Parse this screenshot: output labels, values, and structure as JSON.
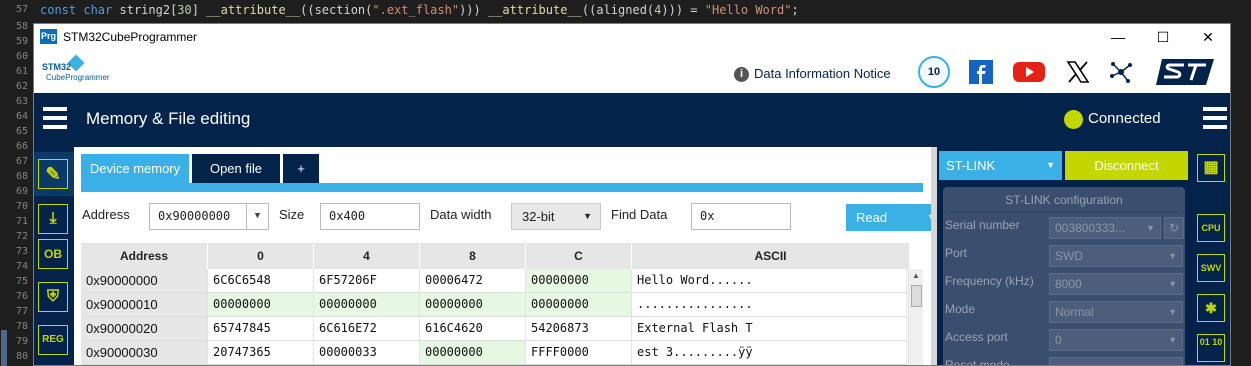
{
  "editor": {
    "line_numbers": [
      "57",
      "58",
      "59",
      "60",
      "61",
      "62",
      "63",
      "64",
      "65",
      "66",
      "67",
      "68",
      "69",
      "70",
      "71",
      "72",
      "73",
      "74",
      "75",
      "76",
      "77",
      "78",
      "79",
      "80"
    ],
    "code_line": {
      "kw1": "const",
      "kw2": "char",
      "ident": " string2[",
      "num1": "30",
      "close": "] ",
      "attr1": "__attribute__",
      "sec_open": "((section(",
      "sec_str": "\".ext_flash\"",
      "sec_close": "))) ",
      "attr2": "__attribute__",
      "al_open": "((aligned(",
      "num2": "4",
      "al_close": "))) = ",
      "value": "\"Hello Word\"",
      "semi": ";"
    }
  },
  "window": {
    "app_icon": "Prg",
    "title": "STM32CubeProgrammer",
    "minimize": "—",
    "maximize": "☐",
    "close": "✕"
  },
  "brand": {
    "logo_line1": "STM32",
    "logo_line2": "CubeProgrammer",
    "info_icon": "i",
    "info_link": "Data Information Notice",
    "badge": "10",
    "social_icons": [
      "facebook-icon",
      "youtube-icon",
      "x-icon",
      "network-icon",
      "st-logo"
    ],
    "st_logo": "ST"
  },
  "header": {
    "title": "Memory & File editing",
    "status": "Connected",
    "status_color": "#c4d600"
  },
  "left_sidebar": {
    "items": [
      {
        "icon": "edit-icon",
        "label": "✎"
      },
      {
        "icon": "download-icon",
        "label": "⤓"
      },
      {
        "icon": "ob-icon",
        "label": "OB"
      },
      {
        "icon": "security-icon",
        "label": "⛨"
      },
      {
        "icon": "reg-icon",
        "label": "REG"
      }
    ]
  },
  "tabs": [
    {
      "label": "Device memory",
      "active": true
    },
    {
      "label": "Open file",
      "active": false
    },
    {
      "label": "+",
      "active": false
    }
  ],
  "toolbar": {
    "address_label": "Address",
    "address_value": "0x90000000",
    "size_label": "Size",
    "size_value": "0x400",
    "width_label": "Data width",
    "width_value": "32-bit",
    "find_label": "Find Data",
    "find_value": "0x",
    "read_label": "Read"
  },
  "table": {
    "columns": [
      "Address",
      "0",
      "4",
      "8",
      "C",
      "ASCII"
    ],
    "rows": [
      {
        "addr": "0x90000000",
        "cells": [
          "6C6C6548",
          "6F57206F",
          "00006472",
          "00000000"
        ],
        "ascii": "Hello Word......"
      },
      {
        "addr": "0x90000010",
        "cells": [
          "00000000",
          "00000000",
          "00000000",
          "00000000"
        ],
        "ascii": "................"
      },
      {
        "addr": "0x90000020",
        "cells": [
          "65747845",
          "6C616E72",
          "616C4620",
          "54206873"
        ],
        "ascii": "External Flash T"
      },
      {
        "addr": "0x90000030",
        "cells": [
          "20747365",
          "00000033",
          "00000000",
          "FFFF0000"
        ],
        "ascii": "est 3.........ÿÿ"
      }
    ]
  },
  "right_panel": {
    "probe": "ST-LINK",
    "disconnect": "Disconnect",
    "config_title": "ST-LINK configuration",
    "fields": [
      {
        "label": "Serial number",
        "value": "003800333..."
      },
      {
        "label": "Port",
        "value": "SWD"
      },
      {
        "label": "Frequency (kHz)",
        "value": "8000"
      },
      {
        "label": "Mode",
        "value": "Normal"
      },
      {
        "label": "Access port",
        "value": "0"
      },
      {
        "label": "Reset mode",
        "value": ""
      }
    ],
    "refresh_icon": "↻"
  },
  "right_sidebar": {
    "items": [
      {
        "icon": "device-map-icon",
        "label": "▦"
      },
      {
        "icon": "cpu-icon",
        "label": "CPU"
      },
      {
        "icon": "swv-icon",
        "label": "SWV"
      },
      {
        "icon": "bug-icon",
        "label": "✱"
      },
      {
        "icon": "binary-icon",
        "label": "01 10"
      }
    ]
  }
}
